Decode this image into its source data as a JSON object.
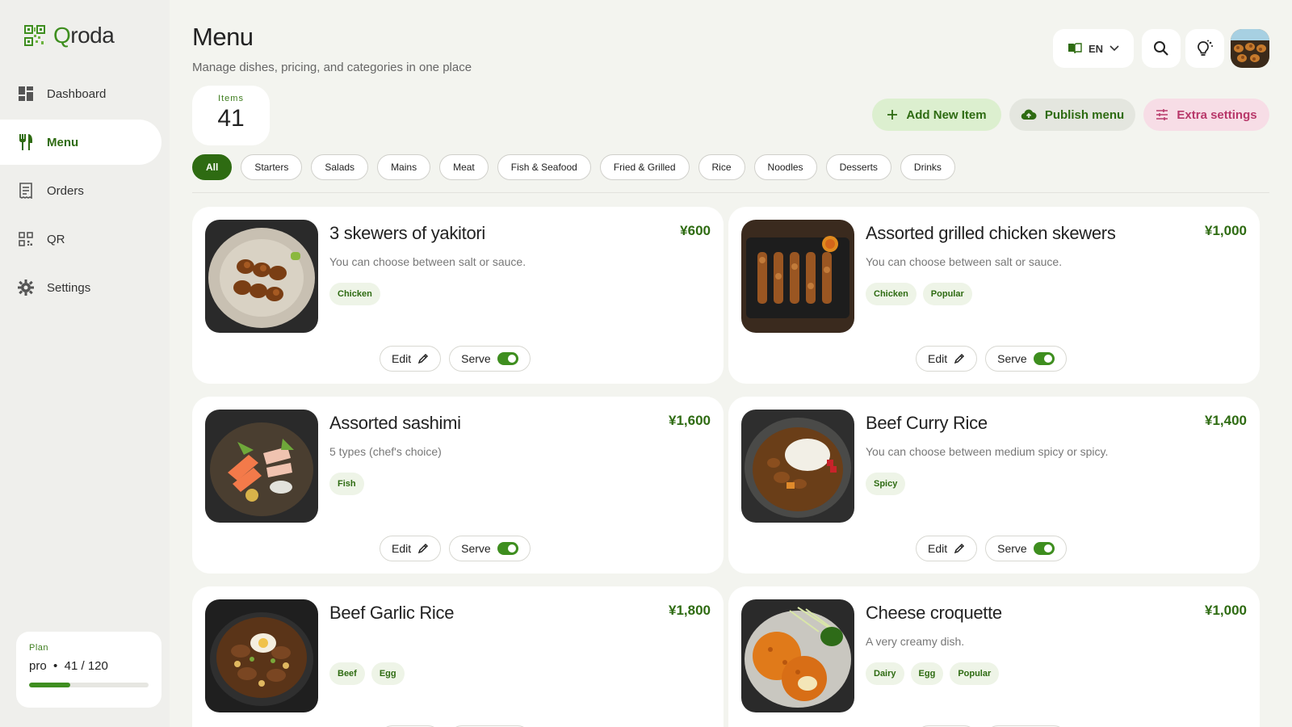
{
  "brand": {
    "name_q": "Q",
    "name_rest": "roda",
    "accent": "#3e8e1f"
  },
  "sidebar": {
    "items": [
      {
        "label": "Dashboard",
        "icon": "dashboard-icon"
      },
      {
        "label": "Menu",
        "icon": "fork-knife-icon"
      },
      {
        "label": "Orders",
        "icon": "receipt-icon"
      },
      {
        "label": "QR",
        "icon": "qr-icon"
      },
      {
        "label": "Settings",
        "icon": "gear-icon"
      }
    ],
    "active_index": 1
  },
  "plan": {
    "label": "Plan",
    "name": "pro",
    "separator": "•",
    "usage": "41 / 120",
    "used": 41,
    "limit": 120
  },
  "header": {
    "title": "Menu",
    "subtitle": "Manage dishes, pricing, and categories in one place",
    "items_label": "Items",
    "items_count": "41",
    "language": "EN"
  },
  "actions": {
    "add": "Add New Item",
    "publish": "Publish menu",
    "extra": "Extra settings"
  },
  "categories": [
    "All",
    "Starters",
    "Salads",
    "Mains",
    "Meat",
    "Fish & Seafood",
    "Fried & Grilled",
    "Rice",
    "Noodles",
    "Desserts",
    "Drinks"
  ],
  "card_labels": {
    "edit": "Edit",
    "serve": "Serve"
  },
  "menu_items": [
    {
      "name": "3 skewers of yakitori",
      "price": "¥600",
      "desc": "You can choose between salt or sauce.",
      "tags": [
        "Chicken"
      ],
      "serving": true
    },
    {
      "name": "Assorted grilled chicken skewers",
      "price": "¥1,000",
      "desc": "You can choose between salt or sauce.",
      "tags": [
        "Chicken",
        "Popular"
      ],
      "serving": true
    },
    {
      "name": "Assorted sashimi",
      "price": "¥1,600",
      "desc": "5 types (chef's choice)",
      "tags": [
        "Fish"
      ],
      "serving": true
    },
    {
      "name": "Beef Curry Rice",
      "price": "¥1,400",
      "desc": "You can choose between medium spicy or spicy.",
      "tags": [
        "Spicy"
      ],
      "serving": true
    },
    {
      "name": "Beef Garlic Rice",
      "price": "¥1,800",
      "desc": "",
      "tags": [
        "Beef",
        "Egg"
      ],
      "serving": true
    },
    {
      "name": "Cheese croquette",
      "price": "¥1,000",
      "desc": "A very creamy dish.",
      "tags": [
        "Dairy",
        "Egg",
        "Popular"
      ],
      "serving": true
    }
  ]
}
